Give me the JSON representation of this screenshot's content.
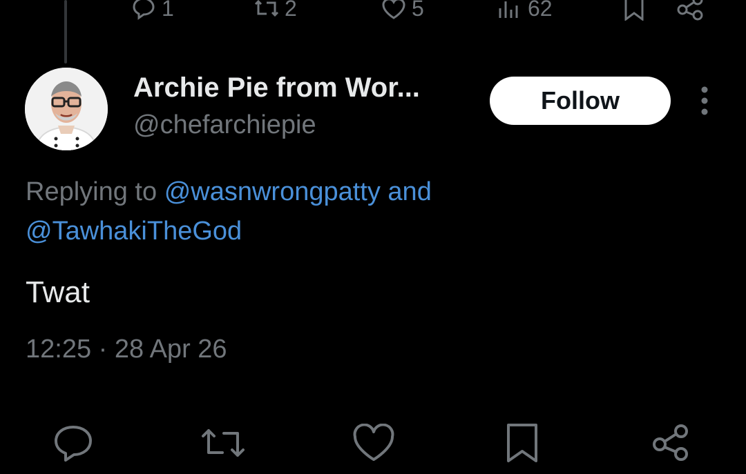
{
  "parent_actions": {
    "replies": "1",
    "reposts": "2",
    "likes": "5",
    "views": "62"
  },
  "author": {
    "name": "Archie Pie from Wor...",
    "handle": "@chefarchiepie"
  },
  "follow_label": "Follow",
  "reply_to": {
    "prefix": "Replying to",
    "mention_1": "@wasnwrongpatty",
    "and": "and",
    "mention_2": "@TawhakiTheGod"
  },
  "tweet_text": "Twat",
  "timestamp": "12:25 · 28 Apr 26",
  "icons": {
    "reply": "reply-icon",
    "repost": "repost-icon",
    "like": "like-icon",
    "views": "views-icon",
    "bookmark": "bookmark-icon",
    "share": "share-icon",
    "more": "more-icon"
  },
  "colors": {
    "background": "#000000",
    "text": "#e7e9ea",
    "muted": "#71767b",
    "mention": "#4a90d9",
    "follow_button": "#ffffff"
  }
}
